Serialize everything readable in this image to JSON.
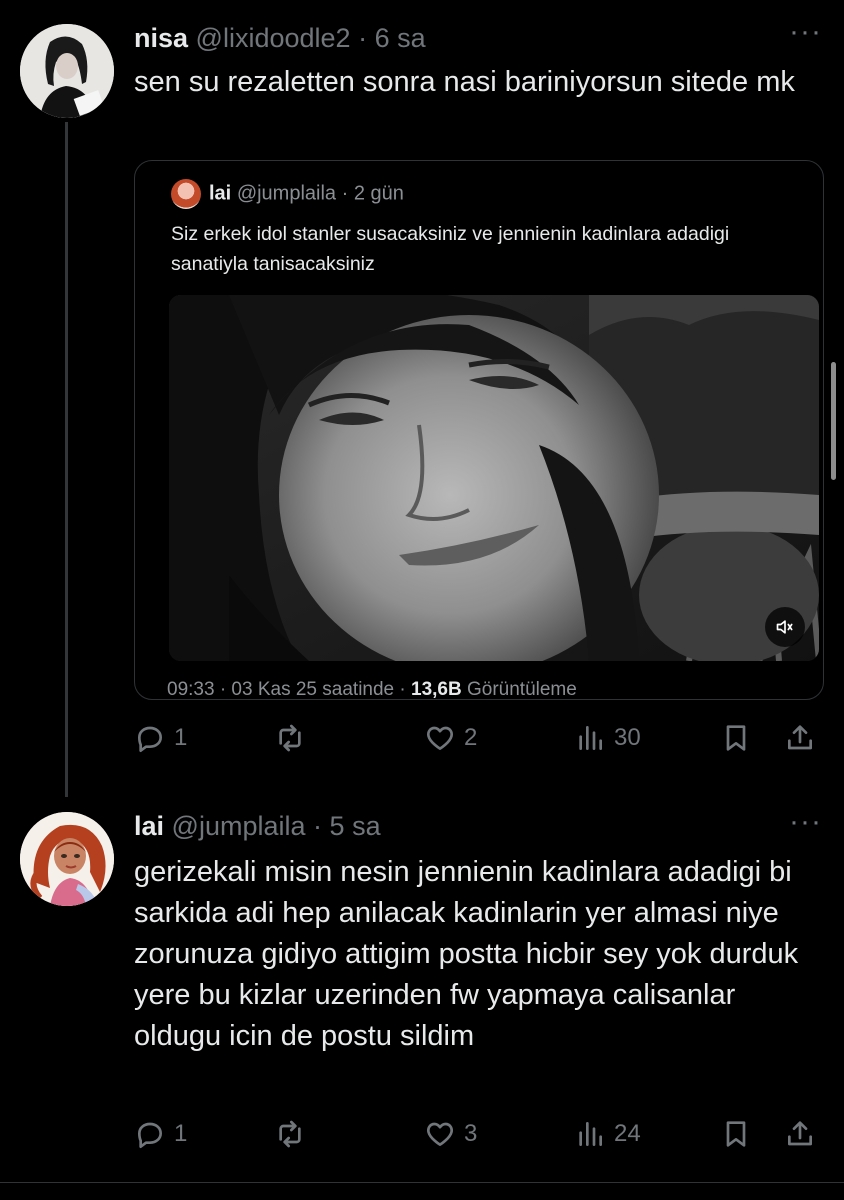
{
  "tweet1": {
    "name": "nisa",
    "handle": "@lixidoodle2",
    "dot": "·",
    "time": "6 sa",
    "text": "sen su rezaletten sonra nasi bariniyorsun sitede mk",
    "more": "···",
    "quote": {
      "name": "lai",
      "handle": "@jumplaila",
      "time": "· 2 gün",
      "text": "Siz erkek idol stanler susacaksiniz ve jennienin kadinlara adadigi sanatiyla tanisacaksiniz",
      "footer_time": "09:33 · 03 Kas 25 saatinde ·",
      "footer_views": "13,6B",
      "footer_views_label": "Görüntüleme"
    },
    "actions": {
      "replies": "1",
      "retweets": "",
      "likes": "2",
      "views": "30"
    }
  },
  "tweet2": {
    "name": "lai",
    "handle": "@jumplaila",
    "dot": "·",
    "time": "5 sa",
    "more": "···",
    "text": "gerizekali misin nesin jennienin kadinlara adadigi bi sarkida adi hep anilacak kadinlarin yer almasi niye zorunuza gidiyo attigim postta hicbir sey yok durduk yere bu kizlar uzerinden fw yapmaya calisanlar oldugu icin de postu sildim",
    "actions": {
      "replies": "1",
      "retweets": "",
      "likes": "3",
      "views": "24"
    }
  },
  "icons": {
    "reply": "reply-icon",
    "retweet": "retweet-icon",
    "like": "heart-icon",
    "views": "views-icon",
    "bookmark": "bookmark-icon",
    "share": "share-icon",
    "sound": "speaker-icon"
  }
}
